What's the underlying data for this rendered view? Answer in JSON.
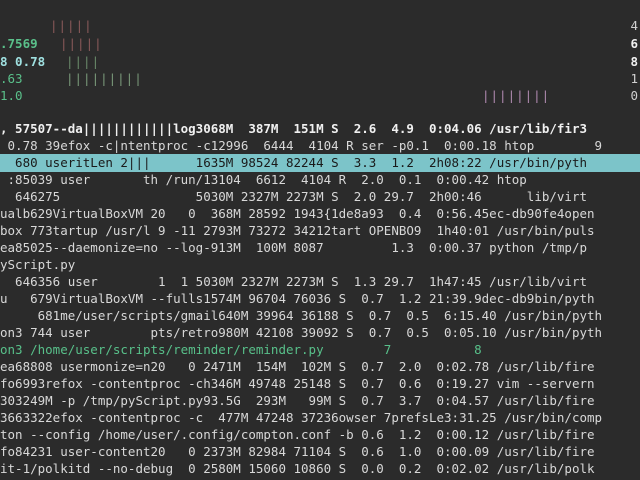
{
  "header_meters": {
    "left_labels": [
      ".7569",
      "8 0.78",
      ".63",
      "1.0"
    ],
    "right_labels": [
      "4",
      "6",
      "8",
      "1",
      "0"
    ]
  },
  "process_rows": [
    ", 57507--da||||||||||||log3068M  387M  151M S  2.6  4.9  0:04.06 /usr/lib/fir3",
    " 0.78 39efox -c|ntentproc -c12996  6444  4104 R ser -p0.1  0:00.18 htop        9",
    "  680 useritLen 2|||      1635M 98524 82244 S  3.3  1.2  2h08:22 /usr/bin/pyth",
    " :85039 user       th /run/13104  6612  4104 R  2.0  0.1  0:00.42 htop",
    "  646275                  5030M 2327M 2273M S  2.0 29.7  2h00:46      lib/virt",
    "ualb629VirtualBoxVM 20   0  368M 28592 1943{1de8a93  0.4  0:56.45ec-db90fe4open",
    "box 773tartup /usr/l 9 -11 2793M 73272 34212tart OPENBO9  1h40:01 /usr/bin/puls",
    "ea85025--daemonize=no --log-913M  100M 8087         1.3  0:00.37 python /tmp/p",
    "yScript.py",
    "  646356 user        1  1 5030M 2327M 2273M S  1.3 29.7  1h47:45 /usr/lib/virt",
    "u   679VirtualBoxVM --fulls1574M 96704 76036 S  0.7  1.2 21:39.9dec-db9bin/pyth",
    "     681me/user/scripts/gmail640M 39964 36188 S  0.7  0.5  6:15.40 /usr/bin/pyth",
    "on3 744 user        pts/retro980M 42108 39092 S  0.7  0.5  0:05.10 /usr/bin/pyth",
    "on3 /home/user/scripts/reminder/reminder.py        7           8",
    "ea68808 usermonize=n20   0 2471M  154M  102M S  0.7  2.0  0:02.78 /usr/lib/fire",
    "fo6993refox -contentproc -ch346M 49748 25148 S  0.7  0.6  0:19.27 vim --servern",
    "303249M -p /tmp/pyScript.py93.5G  293M   99M S  0.7  3.7  0:04.57 /usr/lib/fire",
    "3663322efox -contentproc -c  477M 47248 37236owser 7prefsLe3:31.25 /usr/bin/comp",
    "ton --config /home/user/.config/compton.conf -b 0.6  1.2  0:00.12 /usr/lib/fire",
    "fo84231 user-content20   0 2373M 82984 71104 S  0.6  1.0  0:00.09 /usr/lib/fire",
    "it-1/polkitd --no-debug  0 2580M 15060 10860 S  0.0  0.2  0:02.02 /usr/lib/polk"
  ]
}
